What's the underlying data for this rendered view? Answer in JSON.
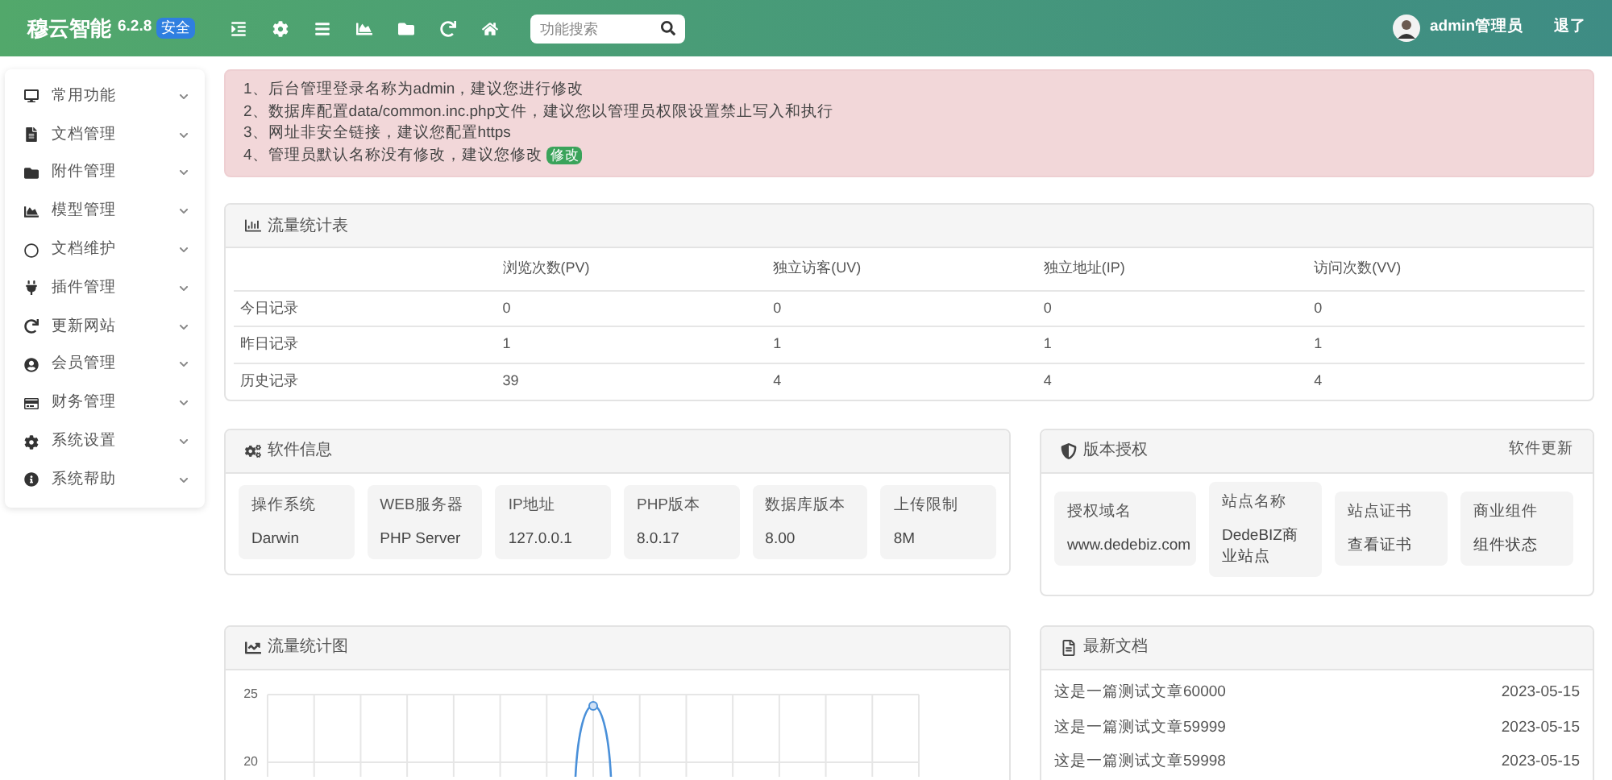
{
  "brand": {
    "name": "穆云智能",
    "version": "6.2.8",
    "badge": "安全"
  },
  "search": {
    "placeholder": "功能搜索"
  },
  "user": {
    "name": "admin管理员",
    "logout": "退了"
  },
  "sidebar": {
    "items": [
      {
        "label": "常用功能"
      },
      {
        "label": "文档管理"
      },
      {
        "label": "附件管理"
      },
      {
        "label": "模型管理"
      },
      {
        "label": "文档维护"
      },
      {
        "label": "插件管理"
      },
      {
        "label": "更新网站"
      },
      {
        "label": "会员管理"
      },
      {
        "label": "财务管理"
      },
      {
        "label": "系统设置"
      },
      {
        "label": "系统帮助"
      }
    ]
  },
  "alert": {
    "lines": [
      "1、后台管理登录名称为admin，建议您进行修改",
      "2、数据库配置data/common.inc.php文件，建议您以管理员权限设置禁止写入和执行",
      "3、网址非安全链接，建议您配置https",
      "4、管理员默认名称没有修改，建议您修改"
    ],
    "action": "修改"
  },
  "traffic_table": {
    "title": "流量统计表",
    "columns": [
      "浏览次数(PV)",
      "独立访客(UV)",
      "独立地址(IP)",
      "访问次数(VV)"
    ],
    "rows": [
      {
        "label": "今日记录",
        "values": [
          "0",
          "0",
          "0",
          "0"
        ]
      },
      {
        "label": "昨日记录",
        "values": [
          "1",
          "1",
          "1",
          "1"
        ]
      },
      {
        "label": "历史记录",
        "values": [
          "39",
          "4",
          "4",
          "4"
        ]
      }
    ]
  },
  "software_info": {
    "title": "软件信息",
    "items": [
      {
        "label": "操作系统",
        "value": "Darwin"
      },
      {
        "label": "WEB服务器",
        "value": "PHP Server"
      },
      {
        "label": "IP地址",
        "value": "127.0.0.1"
      },
      {
        "label": "PHP版本",
        "value": "8.0.17"
      },
      {
        "label": "数据库版本",
        "value": "8.00"
      },
      {
        "label": "上传限制",
        "value": "8M"
      }
    ]
  },
  "license": {
    "title": "版本授权",
    "link": "软件更新",
    "items": [
      {
        "label": "授权域名",
        "value": "www.dedebiz.com"
      },
      {
        "label": "站点名称",
        "value": "DedeBIZ商业站点"
      },
      {
        "label": "站点证书",
        "value": "查看证书"
      },
      {
        "label": "商业组件",
        "value": "组件状态"
      }
    ]
  },
  "traffic_chart": {
    "title": "流量统计图",
    "y_tick_labels": [
      "25",
      "20"
    ]
  },
  "latest_docs": {
    "title": "最新文档",
    "rows": [
      {
        "title": "这是一篇测试文章60000",
        "date": "2023-05-15"
      },
      {
        "title": "这是一篇测试文章59999",
        "date": "2023-05-15"
      },
      {
        "title": "这是一篇测试文章59998",
        "date": "2023-05-15"
      }
    ]
  }
}
